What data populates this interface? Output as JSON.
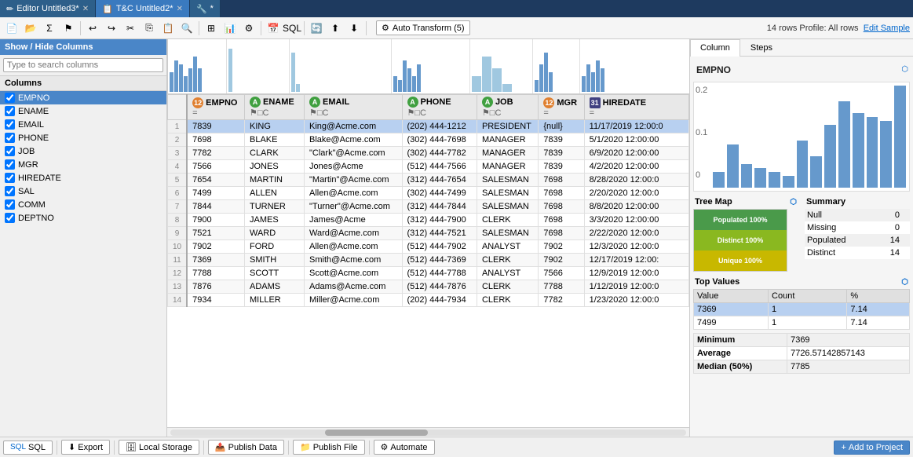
{
  "titlebar": {
    "tabs": [
      {
        "label": "Editor Untitled3*",
        "active": false,
        "icon": "✏"
      },
      {
        "label": "T&C Untitled2*",
        "active": true,
        "icon": "📋"
      },
      {
        "label": "*",
        "active": false,
        "icon": "🔧"
      }
    ]
  },
  "toolbar": {
    "auto_transform_label": "Auto Transform (5)",
    "rows_info": "14 rows  Profile: All rows",
    "edit_sample_label": "Edit Sample"
  },
  "sidebar": {
    "header": "Show / Hide Columns",
    "search_placeholder": "Type to search columns",
    "columns_header": "Columns",
    "items": [
      {
        "label": "EMPNO",
        "checked": true,
        "active": true
      },
      {
        "label": "ENAME",
        "checked": true,
        "active": false
      },
      {
        "label": "EMAIL",
        "checked": true,
        "active": false
      },
      {
        "label": "PHONE",
        "checked": true,
        "active": false
      },
      {
        "label": "JOB",
        "checked": true,
        "active": false
      },
      {
        "label": "MGR",
        "checked": true,
        "active": false
      },
      {
        "label": "HIREDATE",
        "checked": true,
        "active": false
      },
      {
        "label": "SAL",
        "checked": true,
        "active": false
      },
      {
        "label": "COMM",
        "checked": true,
        "active": false
      },
      {
        "label": "DEPTNO",
        "checked": true,
        "active": false
      }
    ]
  },
  "table": {
    "columns": [
      {
        "name": "EMPNO",
        "type": "num",
        "type_label": "12"
      },
      {
        "name": "ENAME",
        "type": "str",
        "type_label": "A"
      },
      {
        "name": "EMAIL",
        "type": "str",
        "type_label": "A"
      },
      {
        "name": "PHONE",
        "type": "str",
        "type_label": "A"
      },
      {
        "name": "JOB",
        "type": "str",
        "type_label": "A"
      },
      {
        "name": "MGR",
        "type": "num",
        "type_label": "12"
      },
      {
        "name": "HIREDATE",
        "type": "date",
        "type_label": "31"
      }
    ],
    "rows": [
      {
        "empno": "7839",
        "ename": "KING",
        "email": "King@Acme.com",
        "phone": "(202) 444-1212",
        "job": "PRESIDENT",
        "mgr": "{null}",
        "hiredate": "11/17/2019 12:00:0"
      },
      {
        "empno": "7698",
        "ename": "BLAKE",
        "email": "Blake@Acme.com",
        "phone": "(302) 444-7698",
        "job": "MANAGER",
        "mgr": "7839",
        "hiredate": "5/1/2020 12:00:00"
      },
      {
        "empno": "7782",
        "ename": "CLARK",
        "email": "\"Clark\"@Acme.com",
        "phone": "(302) 444-7782",
        "job": "MANAGER",
        "mgr": "7839",
        "hiredate": "6/9/2020 12:00:00"
      },
      {
        "empno": "7566",
        "ename": "JONES",
        "email": "Jones@Acme",
        "phone": "(512) 444-7566",
        "job": "MANAGER",
        "mgr": "7839",
        "hiredate": "4/2/2020 12:00:00"
      },
      {
        "empno": "7654",
        "ename": "MARTIN",
        "email": "\"Martin\"@Acme.com",
        "phone": "(312) 444-7654",
        "job": "SALESMAN",
        "mgr": "7698",
        "hiredate": "8/28/2020 12:00:0"
      },
      {
        "empno": "7499",
        "ename": "ALLEN",
        "email": "Allen@Acme.com",
        "phone": "(302) 444-7499",
        "job": "SALESMAN",
        "mgr": "7698",
        "hiredate": "2/20/2020 12:00:0"
      },
      {
        "empno": "7844",
        "ename": "TURNER",
        "email": "\"Turner\"@Acme.com",
        "phone": "(312) 444-7844",
        "job": "SALESMAN",
        "mgr": "7698",
        "hiredate": "8/8/2020 12:00:00"
      },
      {
        "empno": "7900",
        "ename": "JAMES",
        "email": "James@Acme",
        "phone": "(312) 444-7900",
        "job": "CLERK",
        "mgr": "7698",
        "hiredate": "3/3/2020 12:00:00"
      },
      {
        "empno": "7521",
        "ename": "WARD",
        "email": "Ward@Acme.com",
        "phone": "(312) 444-7521",
        "job": "SALESMAN",
        "mgr": "7698",
        "hiredate": "2/22/2020 12:00:0"
      },
      {
        "empno": "7902",
        "ename": "FORD",
        "email": "Allen@Acme.com",
        "phone": "(512) 444-7902",
        "job": "ANALYST",
        "mgr": "7902",
        "hiredate": "12/3/2020 12:00:0"
      },
      {
        "empno": "7369",
        "ename": "SMITH",
        "email": "Smith@Acme.com",
        "phone": "(512) 444-7369",
        "job": "CLERK",
        "mgr": "7902",
        "hiredate": "12/17/2019 12:00:"
      },
      {
        "empno": "7788",
        "ename": "SCOTT",
        "email": "Scott@Acme.com",
        "phone": "(512) 444-7788",
        "job": "ANALYST",
        "mgr": "7566",
        "hiredate": "12/9/2019 12:00:0"
      },
      {
        "empno": "7876",
        "ename": "ADAMS",
        "email": "Adams@Acme.com",
        "phone": "(512) 444-7876",
        "job": "CLERK",
        "mgr": "7788",
        "hiredate": "1/12/2019 12:00:0"
      },
      {
        "empno": "7934",
        "ename": "MILLER",
        "email": "Miller@Acme.com",
        "phone": "(202) 444-7934",
        "job": "CLERK",
        "mgr": "7782",
        "hiredate": "1/23/2020 12:00:0"
      }
    ]
  },
  "right_panel": {
    "tabs": [
      "Column",
      "Steps"
    ],
    "active_tab": "Column",
    "column_name": "EMPNO",
    "chart_y_labels": [
      "0.2",
      "0.1",
      "0"
    ],
    "chart_bars": [
      20,
      55,
      30,
      25,
      20,
      15,
      60,
      40,
      80,
      110,
      95,
      90,
      85,
      130
    ],
    "treemap": {
      "title": "Tree Map",
      "segments": [
        {
          "label": "Populated 100%",
          "color": "#4a9a4a",
          "top": "0",
          "left": "0",
          "width": "100%",
          "height": "33%"
        },
        {
          "label": "Distinct 100%",
          "color": "#a0c040",
          "top": "33%",
          "left": "0",
          "width": "100%",
          "height": "34%"
        },
        {
          "label": "Unique 100%",
          "color": "#d0c000",
          "top": "67%",
          "left": "0",
          "width": "100%",
          "height": "33%"
        }
      ]
    },
    "summary": {
      "title": "Summary",
      "rows": [
        {
          "label": "Null",
          "value": "0"
        },
        {
          "label": "Missing",
          "value": "0"
        },
        {
          "label": "Populated",
          "value": "14"
        },
        {
          "label": "Distinct",
          "value": "14"
        }
      ]
    },
    "top_values": {
      "title": "Top Values",
      "columns": [
        "Value",
        "Count",
        "%"
      ],
      "rows": [
        {
          "value": "7369",
          "count": "1",
          "pct": "7.14",
          "selected": true
        },
        {
          "value": "7499",
          "count": "1",
          "pct": "7.14",
          "selected": false
        }
      ]
    },
    "stats": {
      "minimum_label": "Minimum",
      "minimum_value": "7369",
      "average_label": "Average",
      "average_value": "7726.57142857143",
      "median_label": "Median (50%)",
      "median_value": "7785"
    }
  },
  "bottom_toolbar": {
    "sql_label": "SQL",
    "export_label": "Export",
    "local_storage_label": "Local Storage",
    "publish_data_label": "Publish Data",
    "publish_file_label": "Publish File",
    "automate_label": "Automate",
    "add_to_project_label": "Add to Project"
  }
}
